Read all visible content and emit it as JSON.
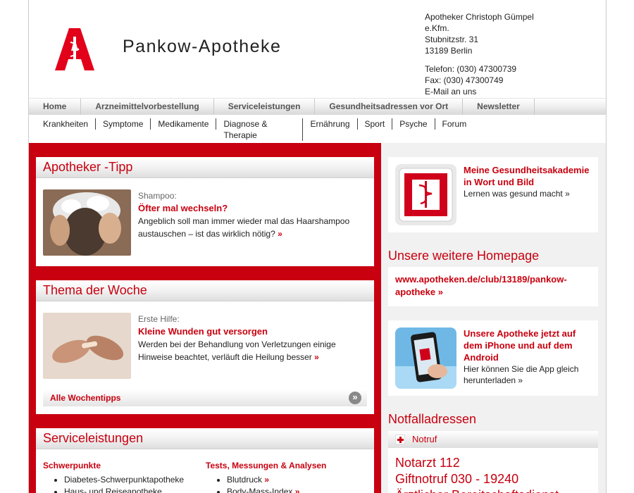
{
  "header": {
    "brand": "Pankow-Apotheke",
    "address": [
      "Apotheker Christoph Gümpel",
      "e.Kfm.",
      "Stubnitzstr. 31",
      "13189 Berlin"
    ],
    "contact": [
      "Telefon: (030) 47300739",
      "Fax: (030) 47300749",
      "E-Mail an uns"
    ]
  },
  "mainnav": [
    "Home",
    "Arzneimittelvorbestellung",
    "Serviceleistungen",
    "Gesundheitsadressen vor Ort",
    "Newsletter"
  ],
  "subnav": [
    "Krankheiten",
    "Symptome",
    "Medikamente",
    "Diagnose & Therapie",
    "Ernährung",
    "Sport",
    "Psyche",
    "Forum"
  ],
  "tipp": {
    "heading": "Apotheker -Tipp",
    "kicker": "Shampoo:",
    "title": "Öfter mal wechseln?",
    "text": "Angeblich soll man immer wieder mal das Haarshampoo austauschen – ist das wirklich nötig?",
    "more": "»"
  },
  "thema": {
    "heading": "Thema der Woche",
    "kicker": "Erste Hilfe:",
    "title": "Kleine Wunden gut versorgen",
    "text": "Werden bei der Behandlung von Verletzungen einige Hinweise beachtet, verläuft die Heilung besser",
    "more": "»",
    "all_label": "Alle Wochentipps",
    "all_icon": "»"
  },
  "service": {
    "heading": "Serviceleistungen",
    "col1_heading": "Schwerpunkte",
    "col1_items": [
      "Diabetes-Schwerpunktapotheke",
      "Haus- und Reiseapotheke"
    ],
    "col2_heading": "Tests, Messungen & Analysen",
    "col2_items": [
      "Blutdruck",
      "Body-Mass-Index"
    ],
    "more": "»"
  },
  "akademie": {
    "title": "Meine Gesundheitsakademie in Wort und Bild",
    "text": "Lernen was gesund macht",
    "more": "»"
  },
  "homepage": {
    "heading": "Unsere weitere Homepage",
    "link": "www.apotheken.de/club/13189/pankow-apotheke",
    "more": "»"
  },
  "app": {
    "title": "Unsere Apotheke jetzt auf dem iPhone und auf dem Android",
    "text": "Hier können Sie die App gleich herunterladen",
    "more": "»"
  },
  "notfall": {
    "heading": "Notfalladressen",
    "tab": "Notruf",
    "lines": [
      "Notarzt 112",
      "Giftnotruf 030 - 19240",
      "Ärztlicher Bereitschaftsdienst"
    ]
  },
  "colors": {
    "accent": "#c8000f",
    "panel": "#f1f1f1"
  }
}
